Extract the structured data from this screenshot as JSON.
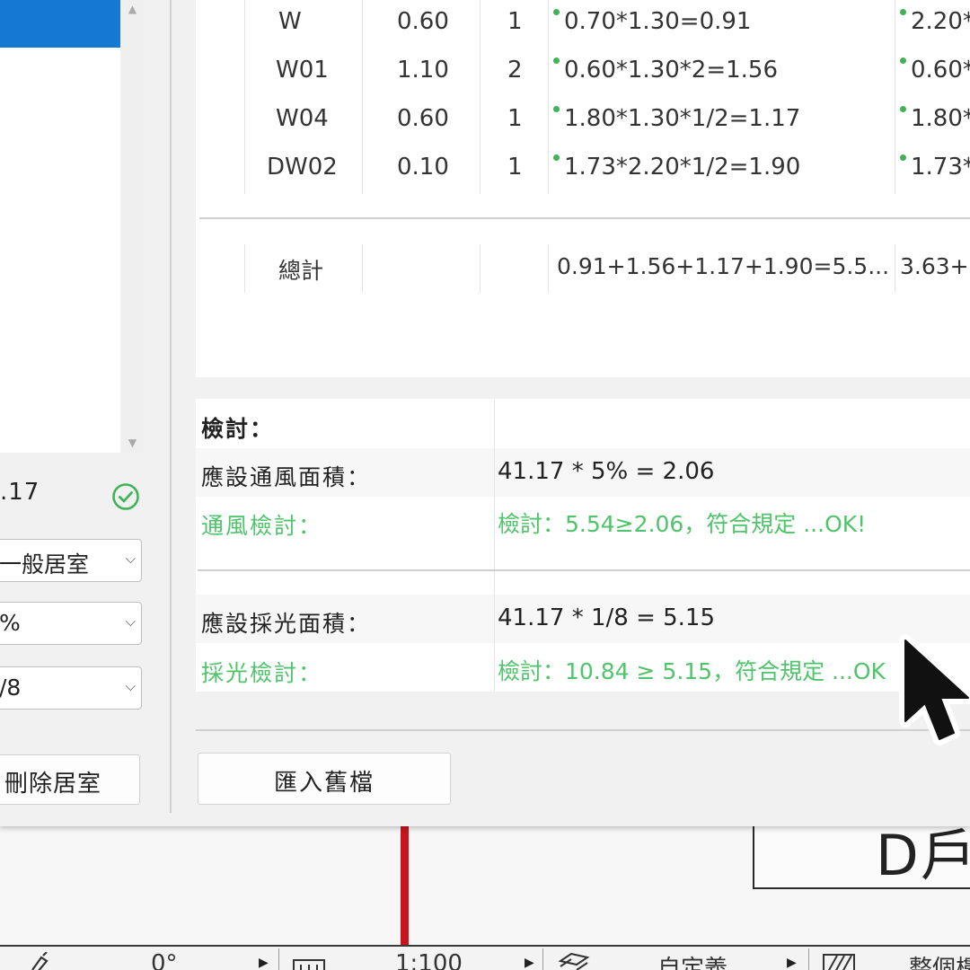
{
  "left_panel": {
    "area_value": ".17",
    "room_type_value": "一般居室",
    "vent_ratio_value": "%",
    "light_ratio_value": "/8",
    "delete_room_label": "刪除居室",
    "icons": {
      "check": "check-circle-icon",
      "scroll_up": "chevron-up-icon",
      "scroll_down": "chevron-down-icon"
    }
  },
  "table": {
    "rows": [
      {
        "name": "W",
        "c2": "0.60",
        "c3": "1",
        "formula": "0.70*1.30=0.91",
        "formula2": "2.20*"
      },
      {
        "name": "W01",
        "c2": "1.10",
        "c3": "2",
        "formula": "0.60*1.30*2=1.56",
        "formula2": "0.60*"
      },
      {
        "name": "W04",
        "c2": "0.60",
        "c3": "1",
        "formula": "1.80*1.30*1/2=1.17",
        "formula2": "1.80*"
      },
      {
        "name": "DW02",
        "c2": "0.10",
        "c3": "1",
        "formula": "1.73*2.20*1/2=1.90",
        "formula2": "1.73*"
      }
    ],
    "total": {
      "label": "總計",
      "formula": "0.91+1.56+1.17+1.90=5.5...",
      "formula2": "3.63+"
    }
  },
  "review": {
    "title": "檢討：",
    "vent_required_label": "應設通風面積：",
    "vent_required_value": "41.17 * 5% = 2.06",
    "vent_check_label": "通風檢討：",
    "vent_check_value": "檢討：5.54≥2.06，符合規定 ...OK!",
    "light_required_label": "應設採光面積：",
    "light_required_value": "41.17 * 1/8 = 5.15",
    "light_check_label": "採光檢討：",
    "light_check_value": "檢討：10.84 ≥ 5.15，符合規定 ...OK",
    "ok_color": "#4fc46a"
  },
  "buttons": {
    "import_label": "匯入舊檔"
  },
  "drawing": {
    "label_fragment": "D戶"
  },
  "status_bar": {
    "angle": "0°",
    "scale": "1:100",
    "custom": "自定義",
    "whole": "整個樓"
  },
  "colors": {
    "selection": "#1578d2",
    "accent_green": "#3fb356",
    "red_line": "#c8141c"
  }
}
